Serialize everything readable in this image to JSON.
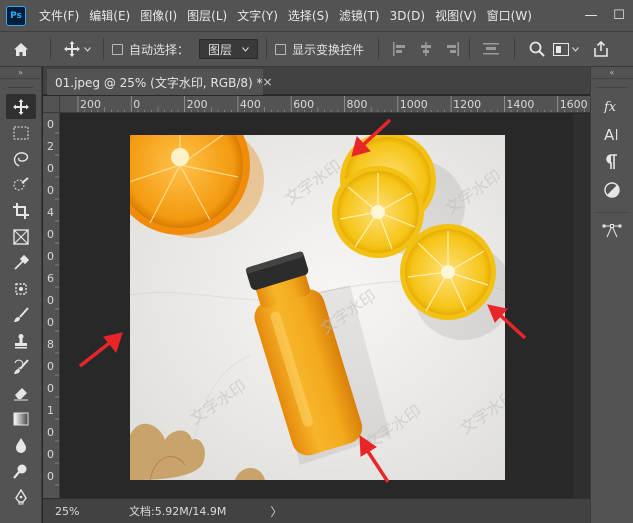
{
  "app": {
    "logo": "Ps"
  },
  "menu": [
    "文件(F)",
    "编辑(E)",
    "图像(I)",
    "图层(L)",
    "文字(Y)",
    "选择(S)",
    "滤镜(T)",
    "3D(D)",
    "视图(V)",
    "窗口(W)"
  ],
  "window_buttons": {
    "minimize": "—",
    "maximize": "☐"
  },
  "options_bar": {
    "auto_select_label": "自动选择：",
    "auto_select_value": "图层",
    "show_transform_label": "显示变换控件"
  },
  "document": {
    "tab_title": "01.jpeg @ 25% (文字水印, RGB/8) *",
    "tab_close": "×"
  },
  "ruler_h": [
    "200",
    "0",
    "200",
    "400",
    "600",
    "800",
    "1000",
    "1200",
    "1400",
    "1600"
  ],
  "ruler_v": [
    "0",
    "2",
    "0",
    "0",
    "4",
    "0",
    "0",
    "6",
    "0",
    "0",
    "8",
    "0",
    "0",
    "1",
    "0",
    "0",
    "0"
  ],
  "watermark_text": "文字水印",
  "status": {
    "zoom": "25%",
    "doc_info": "文档:5.92M/14.9M",
    "arrow": "〉"
  },
  "icons": {
    "left_tools": [
      "move-tool-icon",
      "marquee-tool-icon",
      "lasso-tool-icon",
      "quick-select-tool-icon",
      "crop-tool-icon",
      "frame-tool-icon",
      "eyedropper-tool-icon",
      "healing-brush-tool-icon",
      "brush-tool-icon",
      "clone-stamp-tool-icon",
      "history-brush-tool-icon",
      "eraser-tool-icon",
      "gradient-tool-icon",
      "blur-tool-icon",
      "dodge-tool-icon",
      "pen-tool-icon"
    ],
    "right_panels": [
      "fx-icon",
      "character-icon",
      "paragraph-icon",
      "adjustments-icon",
      "paths-icon"
    ]
  },
  "colors": {
    "accent_red": "#e8262a",
    "ui_gray": "#535353",
    "pasteboard": "#282828",
    "juice": "#f2a71b"
  }
}
